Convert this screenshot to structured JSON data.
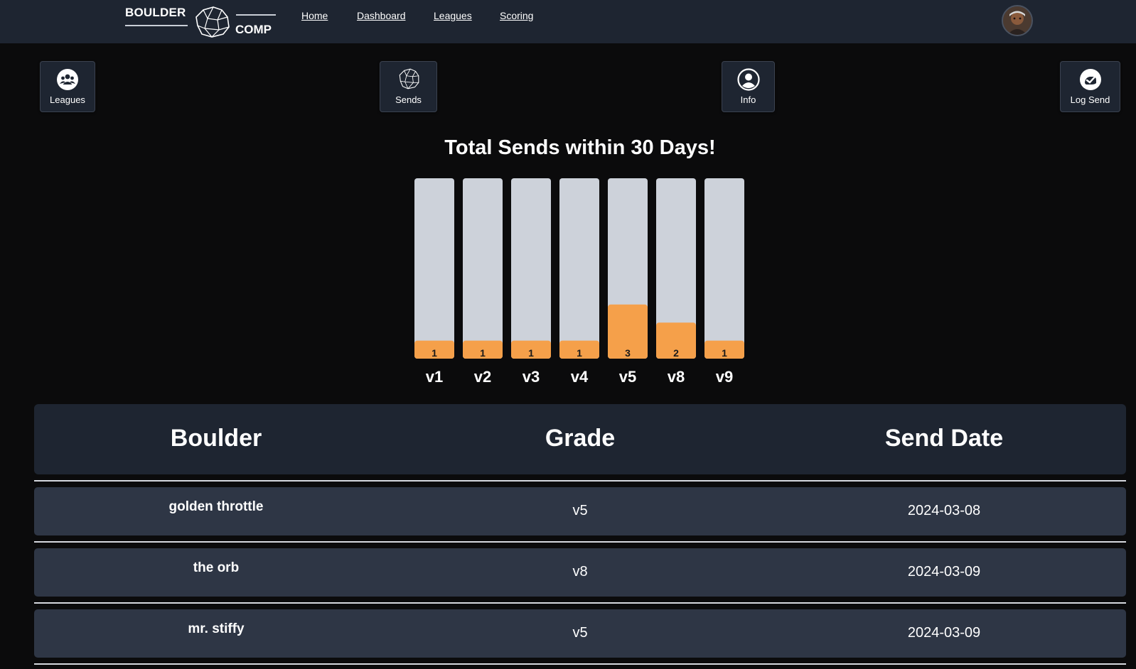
{
  "brand": {
    "word_top": "BOULDER",
    "word_bottom": "COMP"
  },
  "nav": {
    "links": [
      "Home",
      "Dashboard",
      "Leagues",
      "Scoring"
    ]
  },
  "user": {
    "avatar_icon": "user-avatar"
  },
  "actions": {
    "leagues": {
      "label": "Leagues",
      "icon": "users-icon"
    },
    "sends": {
      "label": "Sends",
      "icon": "boulder-icon"
    },
    "info": {
      "label": "Info",
      "icon": "user-circle-icon"
    },
    "log_send": {
      "label": "Log Send",
      "icon": "check-badge-icon"
    }
  },
  "chart_data": {
    "type": "bar",
    "title": "Total Sends within 30 Days!",
    "categories": [
      "v1",
      "v2",
      "v3",
      "v4",
      "v5",
      "v8",
      "v9"
    ],
    "values": [
      1,
      1,
      1,
      1,
      3,
      2,
      1
    ],
    "ylim": [
      0,
      10
    ],
    "grid": false,
    "colors": {
      "fill": "#f5a04a",
      "track": "#cdd2da"
    }
  },
  "table": {
    "headers": [
      "Boulder",
      "Grade",
      "Send Date"
    ],
    "rows": [
      {
        "boulder": "golden throttle",
        "grade": "v5",
        "date": "2024-03-08"
      },
      {
        "boulder": "the orb",
        "grade": "v8",
        "date": "2024-03-09"
      },
      {
        "boulder": "mr. stiffy",
        "grade": "v5",
        "date": "2024-03-09"
      }
    ]
  },
  "colors": {
    "page_bg": "#0b0b0c",
    "nav_bg": "#1e2531",
    "row_bg": "#2e3645",
    "accent": "#f5a04a"
  }
}
